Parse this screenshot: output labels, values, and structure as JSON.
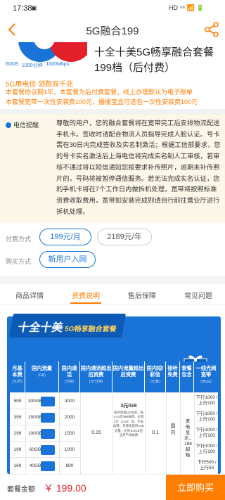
{
  "status_bar": {
    "time": "17:38",
    "icons": "HD ⁴⁶ 📶 🔋"
  },
  "nav": {
    "title": "5G融合199"
  },
  "product": {
    "image_specs": [
      "60GB",
      "1000分钟",
      "1000Mbps"
    ],
    "name": "十全十美5G畅享融合套餐199档（后付费）",
    "slogan": "5G用电信 领跑双千兆",
    "notes": [
      "本套餐协议期1年，本套餐为后付费套餐，线上办理默认为电子账单",
      "本套餐宽带一次性安装费100元，播播宝盒可选包一次性安装费100元"
    ]
  },
  "notice": {
    "label": "电信提醒",
    "text": "尊敬的用户，您的融合套餐将在宽带完工后安排物流配送手机卡。签收时请配合物流人员指导完成人脸认证。号卡需在30日内完成签收及实名制激活；根据工信部要求，您的号卡实名激活后上海电信将完成实名制人工审核，若审核不通过将以短信通知您按要求补传照片，逾期未补传照片的，号码将被暂停通信服务。若无法完成实名认证，您的手机卡将在7个工作日内做拆机处理，宽带将按照标准资费收取费用，宽带如安装完成则请自行前往营业厅进行拆机处理。"
  },
  "payment": {
    "label": "付费方式",
    "options": [
      "199元/月",
      "2189元/年"
    ]
  },
  "purchase": {
    "label": "购买方式",
    "options": [
      "新用户入网"
    ]
  },
  "tabs": [
    "商品详情",
    "资费说明",
    "售后保障",
    "常见问题"
  ],
  "banner": {
    "title_big": "十全十美",
    "title_small": "5G畅享融合套餐",
    "headers": [
      {
        "t": "月基本费",
        "s": "(元/月)"
      },
      {
        "t": "国内流量",
        "s": "(GB)"
      },
      {
        "t": "国内通话",
        "s": "(分钟)"
      },
      {
        "t": "国内通话超出后资费",
        "s": "(元/分钟)"
      },
      {
        "t": "国内流量超出后资费",
        "s": ""
      },
      {
        "t": "国内短/彩信",
        "s": "(元/条)"
      },
      {
        "t": "接听免费",
        "s": ""
      },
      {
        "t": "套餐包含",
        "s": ""
      },
      {
        "t": "一线光网宽带",
        "s": "(Mbps)"
      }
    ],
    "rows": [
      {
        "fee": "599",
        "flow": "300GB",
        "voice": "3000",
        "bw": "下行1000 /上行100"
      },
      {
        "fee": "399",
        "flow": "150GB",
        "voice": "2000",
        "bw": "下行1000 /上行100"
      },
      {
        "fee": "299",
        "flow": "100GB",
        "voice": "1500",
        "bw": "下行1000 /上行100"
      },
      {
        "fee": "199",
        "flow": "60GB",
        "voice": "1000",
        "bw": "下行1000 /上行100"
      },
      {
        "fee": "169",
        "flow": "40GB",
        "voice": "800",
        "bw": "下行500 /上行50"
      }
    ],
    "voice_over": "0.15",
    "flow_over_main": "3元/GB",
    "flow_over_note": "每月用满10GB后，按0.03元/MB收费，达到3元（1GB）后，不再收费，可继续使用1GB流量；达到100GB后当月不再收费",
    "sms": "0.1",
    "receive": "国内",
    "package": "来电显示，189邮箱"
  },
  "bottom": {
    "label": "套餐金额",
    "price": "￥ 199.00",
    "buy": "立即购买"
  }
}
